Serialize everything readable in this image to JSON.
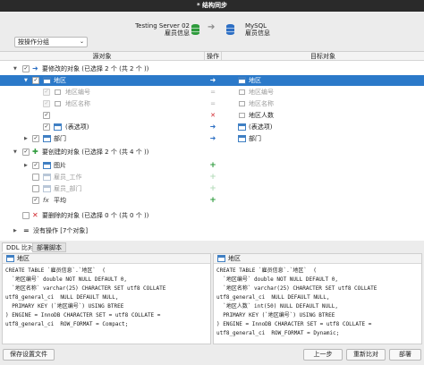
{
  "window": {
    "title": "* 结构同步"
  },
  "header": {
    "source": {
      "server": "Testing Server 02",
      "database": "雇员信息"
    },
    "target": {
      "server": "MySQL",
      "database": "雇员信息"
    }
  },
  "group_select": {
    "value": "按操作分组"
  },
  "columns": {
    "source": "源对象",
    "operation": "操作",
    "target": "目标对象"
  },
  "sections": {
    "modify": {
      "label": "要修改的对象 (已选择 2 个 (共 2 个 ))"
    },
    "create": {
      "label": "要创建的对象 (已选择 2 个 (共 4 个 ))"
    },
    "delete": {
      "label": "要删除的对象 (已选择 0 个 (共 0 个 ))"
    },
    "none": {
      "label": "没有操作 [7个对象]"
    }
  },
  "rows": {
    "district": {
      "source": "地区",
      "target": "地区"
    },
    "district_code": {
      "source": "地区编号",
      "target": "地区编号"
    },
    "district_name": {
      "source": "地区名称",
      "target": "地区名称"
    },
    "region_count": {
      "target": "地区人数"
    },
    "options": {
      "source": "(表选项)",
      "target": "(表选项)"
    },
    "dept": {
      "source": "部门",
      "target": "部门"
    },
    "photo": {
      "source": "图片"
    },
    "employee_job": {
      "source": "雇员_工作"
    },
    "employee_dept": {
      "source": "雇员_部门"
    },
    "avg": {
      "source": "平均"
    }
  },
  "ddl": {
    "tabs": {
      "compare": "DDL 比对",
      "deploy": "部署脚本"
    },
    "left_table": "地区",
    "right_table": "地区",
    "left_lines": [
      "CREATE TABLE `雇员信息`.`地区`  (",
      "  `地区编号` double NOT NULL DEFAULT 0,",
      "  `地区名称` varchar(25) CHARACTER SET utf8 COLLATE",
      "utf8_general_ci  NULL DEFAULT NULL,",
      "  PRIMARY KEY (`地区编号`) USING BTREE",
      ") ENGINE = InnoDB CHARACTER SET = utf8 COLLATE =",
      "utf8_general_ci  ROW_FORMAT = Compact;"
    ],
    "right_lines": [
      "CREATE TABLE `雇员信息`.`地区`  (",
      "  `地区编号` double NOT NULL DEFAULT 0,",
      "  `地区名称` varchar(25) CHARACTER SET utf8 COLLATE",
      "utf8_general_ci  NULL DEFAULT NULL,",
      "  `地区人数` int(50) NULL DEFAULT NULL,",
      "  PRIMARY KEY (`地区编号`) USING BTREE",
      ") ENGINE = InnoDB CHARACTER SET = utf8 COLLATE =",
      "utf8_general_ci  ROW_FORMAT = Dynamic;"
    ]
  },
  "footer": {
    "save_profile": "保存设置文件",
    "prev": "上一步",
    "recompare": "重新比对",
    "next": "部署"
  },
  "colors": {
    "selection": "#2b79c9",
    "add": "#2e9b3c",
    "remove": "#d0262c",
    "modify": "#2d6fc4"
  }
}
